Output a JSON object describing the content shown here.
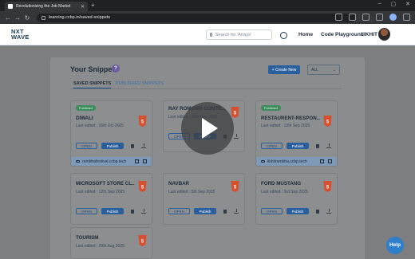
{
  "browser": {
    "tab_title": "Revolutionizing the Job Market",
    "url": "learning.ccbp.in/saved-snippets"
  },
  "header": {
    "logo_line1": "NXT",
    "logo_line2": "WAVE",
    "search_placeholder": "Search for 'Arrays'",
    "nav": [
      "Home",
      "Code Playground"
    ],
    "user_name": "LIKHIT"
  },
  "snippets_page": {
    "title": "Your Snippets",
    "badge": "?",
    "create_label": "+ Create New",
    "filter_value": "ALL",
    "tabs": [
      "SAVED SNIPPETS",
      "PUBLISHED SNIPPETS"
    ]
  },
  "card_labels": {
    "published_tag": "Published",
    "open": "OPEN",
    "publish": "Publish"
  },
  "snippets": [
    {
      "name": "DIWALI",
      "edited": "Last edited : 16th Oct 2025",
      "published": true,
      "url": "rambhafestival.ccbp.tech"
    },
    {
      "name": "RAY ROMONO CONTR...",
      "edited": "Last edited : 16th Sep 2025",
      "published": false,
      "url": ""
    },
    {
      "name": "RESTAURENT-RESPON...",
      "edited": "Last edited : 12th Sep 2025",
      "published": true,
      "url": "likhitrambha.ccbp.tech"
    },
    {
      "name": "MICROSOFT STORE CL...",
      "edited": "Last edited : 12th Sep 2025",
      "published": false,
      "url": ""
    },
    {
      "name": "NAVBAR",
      "edited": "Last edited : 5th Sep 2025",
      "published": false,
      "url": ""
    },
    {
      "name": "FORD MUSTANG",
      "edited": "Last edited : 3rd Sep 2025",
      "published": false,
      "url": ""
    },
    {
      "name": "TOURISM",
      "edited": "Last edited : 29th Aug 2025",
      "published": false,
      "url": ""
    }
  ],
  "help_label": "Help"
}
